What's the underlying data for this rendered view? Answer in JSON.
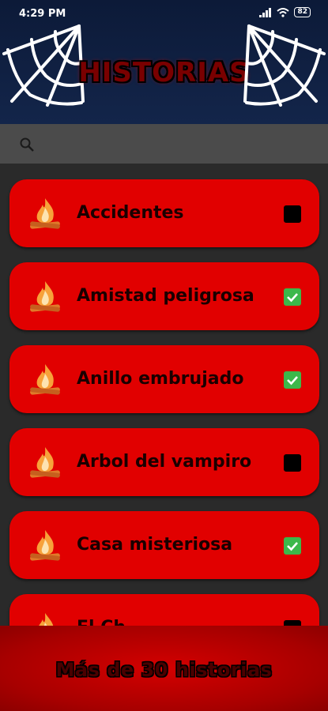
{
  "status_bar": {
    "time": "4:29 PM",
    "battery": "82"
  },
  "header": {
    "title": "HISTORIAS"
  },
  "search": {
    "placeholder": ""
  },
  "stories": [
    {
      "label": "Accidentes",
      "checked": false
    },
    {
      "label": "Amistad peligrosa",
      "checked": true
    },
    {
      "label": "Anillo embrujado",
      "checked": true
    },
    {
      "label": "Arbol del vampiro",
      "checked": false
    },
    {
      "label": "Casa misteriosa",
      "checked": true
    },
    {
      "label": "El Ch",
      "checked": false
    }
  ],
  "footer": {
    "banner_text": "Más de 30 historias"
  },
  "colors": {
    "card": "#e10000",
    "check_on": "#3cb84a",
    "header": "#0f1f42"
  }
}
